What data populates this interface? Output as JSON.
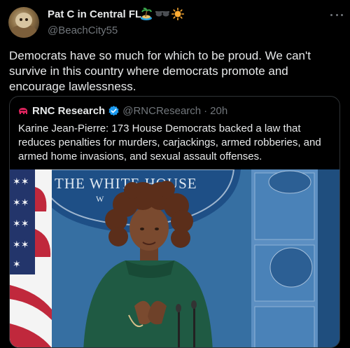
{
  "author": {
    "name": "Pat C in Central FL",
    "handle": "@BeachCity55",
    "name_emojis": [
      "island-emoji",
      "sunglasses-emoji",
      "sun-emoji"
    ]
  },
  "tweet": {
    "text": "Democrats have so much for which to be proud. We can't survive in this country where democrats promote and encourage lawlessness."
  },
  "quoted": {
    "name": "RNC Research",
    "handle": "@RNCResearch",
    "separator": "·",
    "time": "20h",
    "text": "Karine Jean-Pierre: 173 House Democrats backed a law that reduces penalties for murders, carjackings, armed robberies, and armed home invasions, and sexual assault offenses.",
    "media_sign_text": "THE WHITE HOUSE",
    "media_sign_sub": "W",
    "colors": {
      "verified": "#1d9bf0",
      "logo": "#e0245e"
    }
  }
}
